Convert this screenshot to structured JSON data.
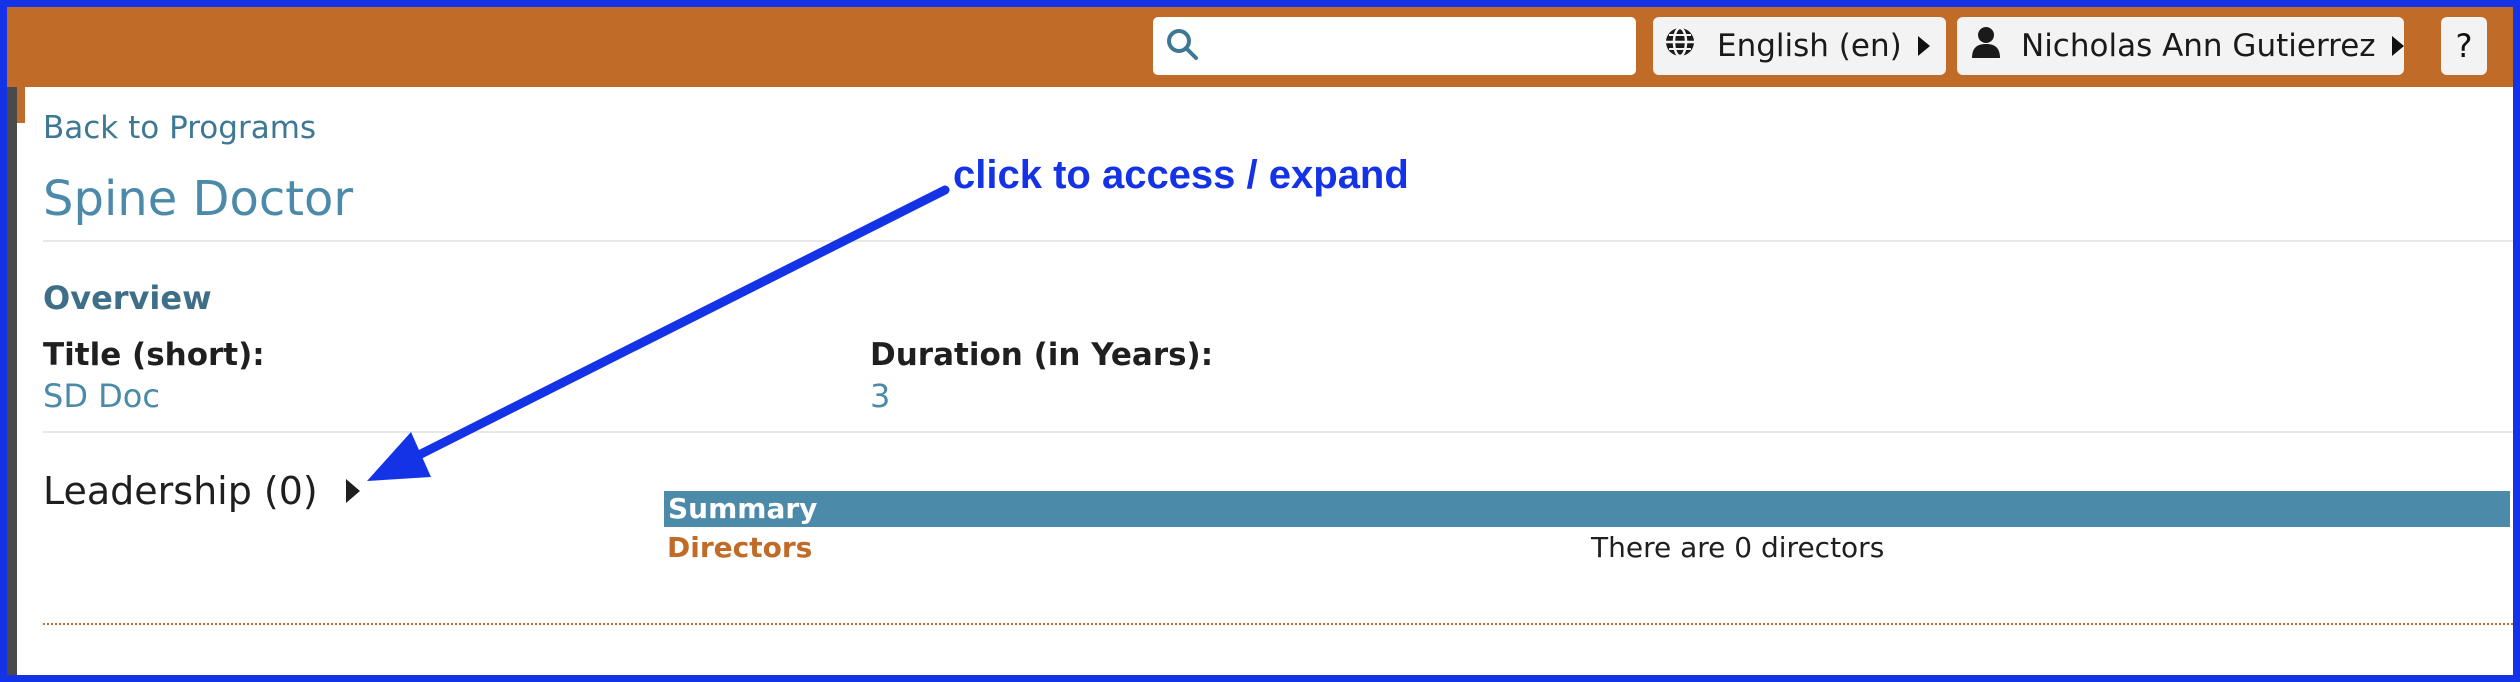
{
  "header": {
    "search": {
      "value": "",
      "placeholder": ""
    },
    "language": {
      "label": "English (en)"
    },
    "user": {
      "name": "Nicholas Ann Gutierrez"
    },
    "help": {
      "label": "?"
    }
  },
  "page": {
    "back_link": "Back to Programs",
    "title": "Spine Doctor"
  },
  "overview": {
    "heading": "Overview",
    "fields": [
      {
        "label": "Title (short):",
        "value": "SD Doc"
      },
      {
        "label": "Duration (in Years):",
        "value": "3"
      }
    ]
  },
  "leadership": {
    "heading": "Leadership (0)",
    "summary_header": "Summary",
    "rows": [
      {
        "label": "Directors",
        "value": "There are 0 directors"
      }
    ]
  },
  "annotation": {
    "text": "click to access / expand"
  },
  "colors": {
    "header_bg": "#c06c28",
    "frame_border": "#1533e6",
    "link": "#4b8aa8",
    "summary_bg": "#4b8aa8",
    "annotation": "#1533e6"
  },
  "icons": {
    "search": "search-icon",
    "language": "globe-icon",
    "user": "user-icon",
    "caret": "caret-right-icon"
  }
}
